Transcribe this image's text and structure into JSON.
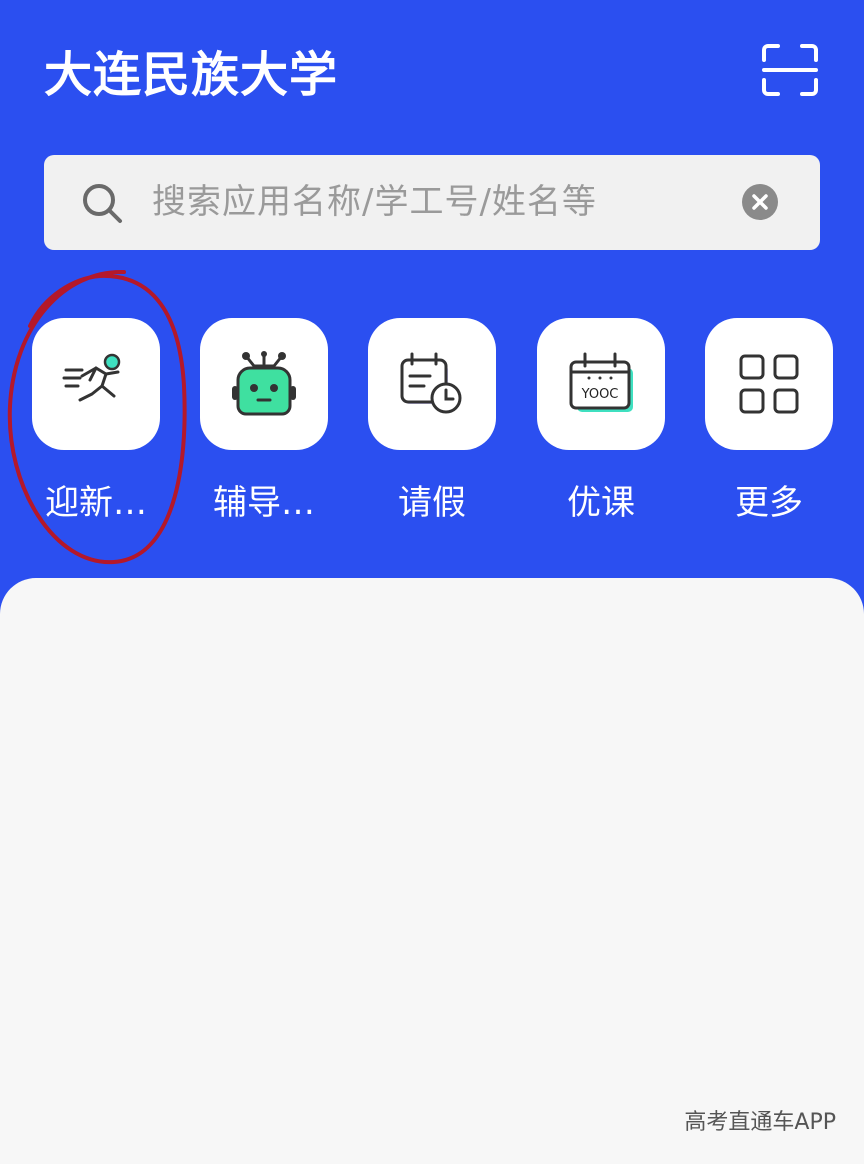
{
  "header": {
    "title": "大连民族大学",
    "scan_icon": "scan-frame-icon"
  },
  "search": {
    "placeholder": "搜索应用名称/学工号/姓名等",
    "search_icon": "search-icon",
    "clear_icon": "clear-icon"
  },
  "apps": [
    {
      "label": "迎新…",
      "icon": "running-person-icon"
    },
    {
      "label": "辅导…",
      "icon": "robot-icon"
    },
    {
      "label": "请假",
      "icon": "calendar-clock-icon"
    },
    {
      "label": "优课",
      "icon": "yooc-calendar-icon"
    },
    {
      "label": "更多",
      "icon": "grid-icon"
    }
  ],
  "yooc_text": "YOOC",
  "watermark": "高考直通车APP",
  "colors": {
    "primary_blue": "#2b4ff0",
    "panel_bg": "#f7f7f7",
    "accent_teal": "#3fe0c0",
    "annotation_red": "#b4182a"
  }
}
